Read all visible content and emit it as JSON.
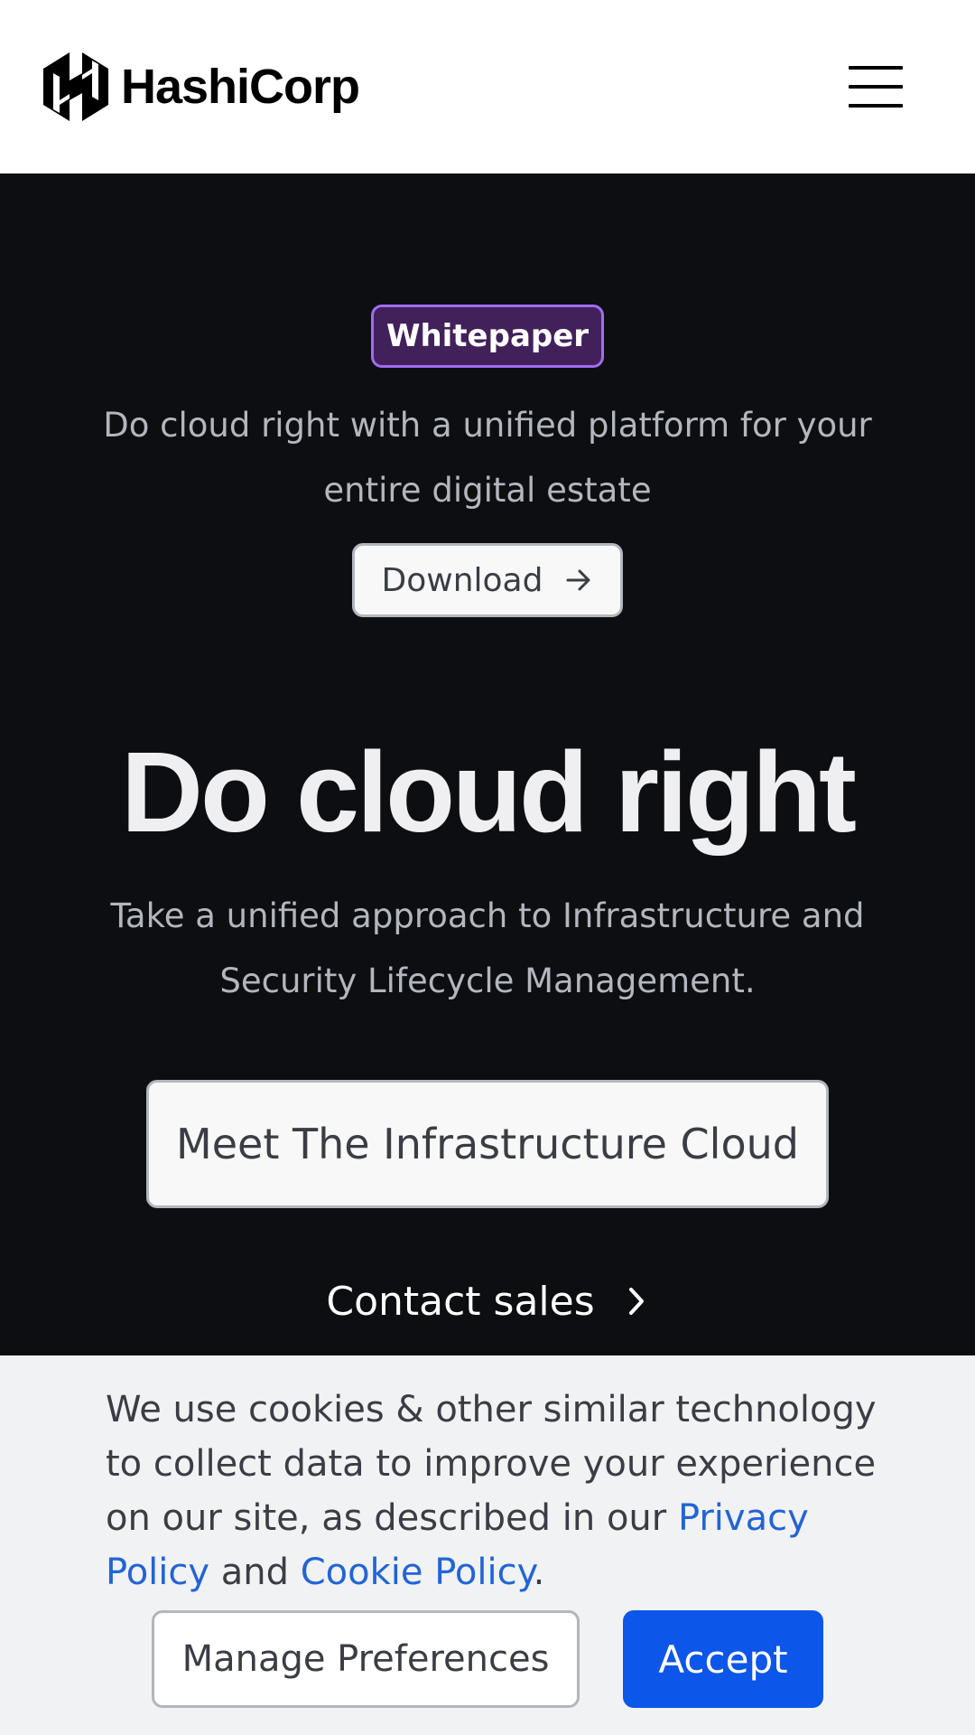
{
  "header": {
    "logo_text": "HashiCorp",
    "logo_icon": "hashicorp-logo-icon",
    "menu_icon": "hamburger-menu-icon"
  },
  "hero": {
    "badge": "Whitepaper",
    "promo_text": "Do cloud right with a unified platform for your entire digital estate",
    "download_label": "Download",
    "download_icon": "arrow-right-icon",
    "headline": "Do cloud right",
    "subhead": "Take a unified approach to Infrastructure and Security Lifecycle Management.",
    "cta_label": "Meet The Infrastructure Cloud",
    "contact_label": "Contact sales",
    "contact_icon": "chevron-right-icon"
  },
  "cookie_banner": {
    "text_before": "We use cookies & other similar technology to collect data to improve your experience on our site, as described in our ",
    "privacy_link": "Privacy Policy",
    "text_and": " and ",
    "cookie_link": "Cookie Policy",
    "text_end": ".",
    "manage_label": "Manage Preferences",
    "accept_label": "Accept"
  },
  "colors": {
    "hero_bg": "#0d0e12",
    "badge_bg": "#42215b",
    "badge_border": "#a26bf2",
    "accept_bg": "#0c56e9",
    "link": "#2264d6"
  }
}
